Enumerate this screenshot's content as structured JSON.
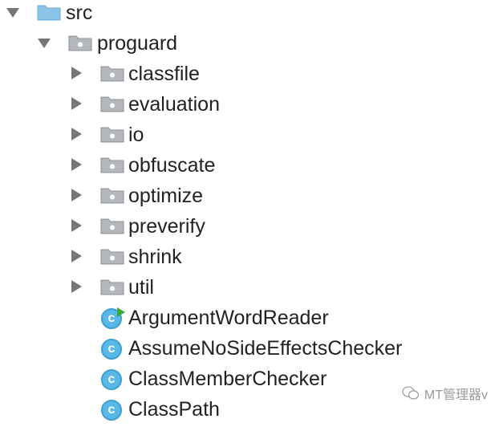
{
  "tree": {
    "root": {
      "label": "src",
      "icon": "source-folder-icon",
      "expanded": true
    },
    "package": {
      "label": "proguard",
      "icon": "package-icon",
      "expanded": true
    },
    "subpackages": [
      {
        "label": "classfile",
        "icon": "package-icon",
        "expanded": false
      },
      {
        "label": "evaluation",
        "icon": "package-icon",
        "expanded": false
      },
      {
        "label": "io",
        "icon": "package-icon",
        "expanded": false
      },
      {
        "label": "obfuscate",
        "icon": "package-icon",
        "expanded": false
      },
      {
        "label": "optimize",
        "icon": "package-icon",
        "expanded": false
      },
      {
        "label": "preverify",
        "icon": "package-icon",
        "expanded": false
      },
      {
        "label": "shrink",
        "icon": "package-icon",
        "expanded": false
      },
      {
        "label": "util",
        "icon": "package-icon",
        "expanded": false
      }
    ],
    "classes": [
      {
        "label": "ArgumentWordReader",
        "icon": "class-runnable-icon",
        "badge": "c"
      },
      {
        "label": "AssumeNoSideEffectsChecker",
        "icon": "class-icon",
        "badge": "c"
      },
      {
        "label": "ClassMemberChecker",
        "icon": "class-icon",
        "badge": "c"
      },
      {
        "label": "ClassPath",
        "icon": "class-icon",
        "badge": "c"
      }
    ]
  },
  "watermark": {
    "text": "MT管理器v",
    "icon": "wechat-icon"
  },
  "colors": {
    "source_folder": "#8cc4e8",
    "package_folder": "#9ea2a6",
    "class_icon": "#58b8e8",
    "run_marker": "#39a83b"
  }
}
